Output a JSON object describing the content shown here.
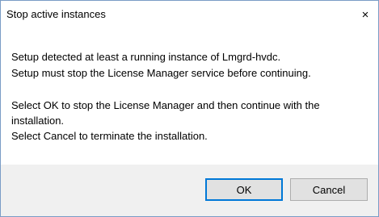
{
  "dialog": {
    "title": "Stop active instances",
    "close_glyph": "×",
    "messages": [
      "Setup detected at least a running instance of Lmgrd-hvdc.",
      "Setup must stop the License Manager service before continuing.",
      "Select OK to stop the License Manager and then continue with the",
      "installation.",
      "Select Cancel to terminate the installation."
    ],
    "buttons": {
      "ok": "OK",
      "cancel": "Cancel"
    },
    "colors": {
      "border": "#7a9cc6",
      "footer_bg": "#f0f0f0",
      "button_bg": "#e1e1e1",
      "default_button_border": "#0078d7"
    }
  }
}
